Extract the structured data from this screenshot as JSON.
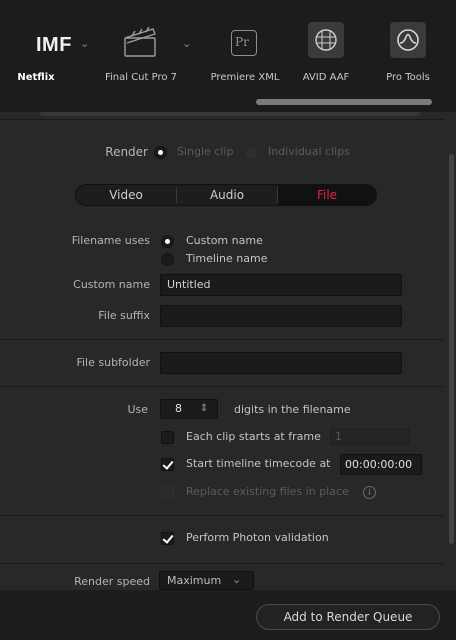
{
  "presets": {
    "imf": {
      "text": "IMF",
      "label": "Netflix"
    },
    "finalcut": {
      "label": "Final Cut Pro 7",
      "icon": "clapperboard-icon"
    },
    "premiere": {
      "label": "Premiere XML",
      "icon_text": "Pr"
    },
    "avid": {
      "label": "AVID AAF",
      "icon": "avid-icon"
    },
    "protools": {
      "label": "Pro Tools",
      "icon": "protools-icon"
    }
  },
  "render": {
    "label": "Render",
    "single": "Single clip",
    "individual": "Individual clips"
  },
  "tabs": {
    "video": "Video",
    "audio": "Audio",
    "file": "File"
  },
  "filename": {
    "uses_label": "Filename uses",
    "custom_option": "Custom name",
    "timeline_option": "Timeline name",
    "custom_name_label": "Custom name",
    "custom_name_value": "Untitled",
    "suffix_label": "File suffix",
    "suffix_value": ""
  },
  "subfolder": {
    "label": "File subfolder",
    "value": ""
  },
  "digits": {
    "use_label": "Use",
    "value": "8",
    "suffix": "digits in the filename",
    "each_clip_label": "Each clip starts at frame",
    "each_clip_value": "1",
    "start_tc_label": "Start timeline timecode at",
    "start_tc_value": "00:00:00:00",
    "replace_label": "Replace existing files in place",
    "info_glyph": "i"
  },
  "photon": {
    "label": "Perform Photon validation"
  },
  "speed": {
    "label": "Render speed",
    "value": "Maximum"
  },
  "footer": {
    "add_button": "Add to Render Queue"
  },
  "colors": {
    "accent_red": "#e6263a",
    "background": "#28282b",
    "topbar": "#1c1c1e"
  }
}
